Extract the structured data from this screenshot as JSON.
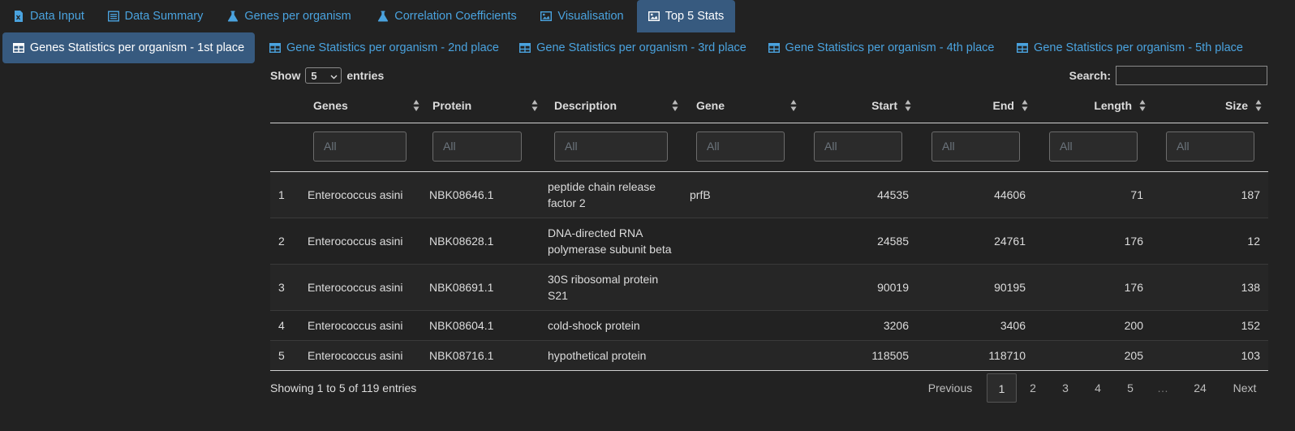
{
  "tabs": [
    {
      "label": "Data Input",
      "icon": "file-excel-icon"
    },
    {
      "label": "Data Summary",
      "icon": "list-alt-icon"
    },
    {
      "label": "Genes per organism",
      "icon": "flask-icon"
    },
    {
      "label": "Correlation Coefficients",
      "icon": "flask-icon"
    },
    {
      "label": "Visualisation",
      "icon": "image-icon"
    },
    {
      "label": "Top 5 Stats",
      "icon": "image-icon",
      "active": true
    }
  ],
  "subtabs": [
    {
      "label": "Genes Statistics per organism - 1st place",
      "active": true
    },
    {
      "label": "Gene Statistics per organism - 2nd place"
    },
    {
      "label": "Gene Statistics per organism - 3rd place"
    },
    {
      "label": "Gene Statistics per organism - 4th place"
    },
    {
      "label": "Gene Statistics per organism - 5th place"
    }
  ],
  "length": {
    "show": "Show",
    "value": "5",
    "entries": "entries"
  },
  "search": {
    "label": "Search:",
    "value": ""
  },
  "table": {
    "columns": [
      "",
      "Genes",
      "Protein",
      "Description",
      "Gene",
      "Start",
      "End",
      "Length",
      "Size"
    ],
    "filter_placeholder": "All",
    "rows": [
      [
        "1",
        "Enterococcus asini",
        "NBK08646.1",
        "peptide chain release factor 2",
        "prfB",
        "44535",
        "44606",
        "71",
        "187"
      ],
      [
        "2",
        "Enterococcus asini",
        "NBK08628.1",
        "DNA-directed RNA polymerase subunit beta",
        "",
        "24585",
        "24761",
        "176",
        "12"
      ],
      [
        "3",
        "Enterococcus asini",
        "NBK08691.1",
        "30S ribosomal protein S21",
        "",
        "90019",
        "90195",
        "176",
        "138"
      ],
      [
        "4",
        "Enterococcus asini",
        "NBK08604.1",
        "cold-shock protein",
        "",
        "3206",
        "3406",
        "200",
        "152"
      ],
      [
        "5",
        "Enterococcus asini",
        "NBK08716.1",
        "hypothetical protein",
        "",
        "118505",
        "118710",
        "205",
        "103"
      ]
    ]
  },
  "info": "Showing 1 to 5 of 119 entries",
  "pagination": {
    "previous": "Previous",
    "pages": [
      "1",
      "2",
      "3",
      "4",
      "5",
      "…",
      "24"
    ],
    "current": "1",
    "next": "Next"
  },
  "colors": {
    "background": "#222222",
    "accent": "#375a7f",
    "link": "#4aa3df"
  }
}
